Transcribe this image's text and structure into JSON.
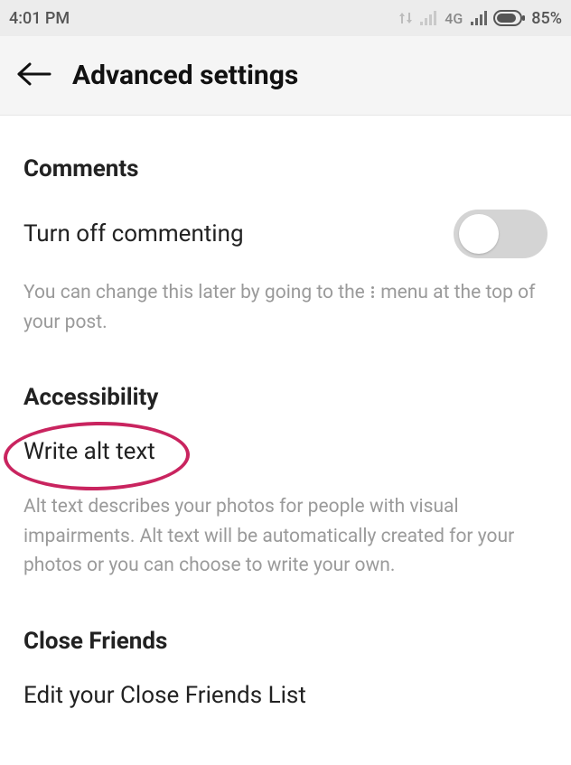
{
  "status": {
    "time": "4:01 PM",
    "network_label": "4G",
    "battery_percent": "85%"
  },
  "header": {
    "title": "Advanced settings"
  },
  "sections": {
    "comments": {
      "title": "Comments",
      "toggle_label": "Turn off commenting",
      "toggle_on": false,
      "helper_before": "You can change this later by going to the ",
      "helper_after": " menu at the top of your post."
    },
    "accessibility": {
      "title": "Accessibility",
      "link_label": "Write alt text",
      "helper": "Alt text describes your photos for people with visual impairments. Alt text will be automatically created for your photos or you can choose to write your own."
    },
    "close_friends": {
      "title": "Close Friends",
      "link_label": "Edit your Close Friends List"
    }
  }
}
